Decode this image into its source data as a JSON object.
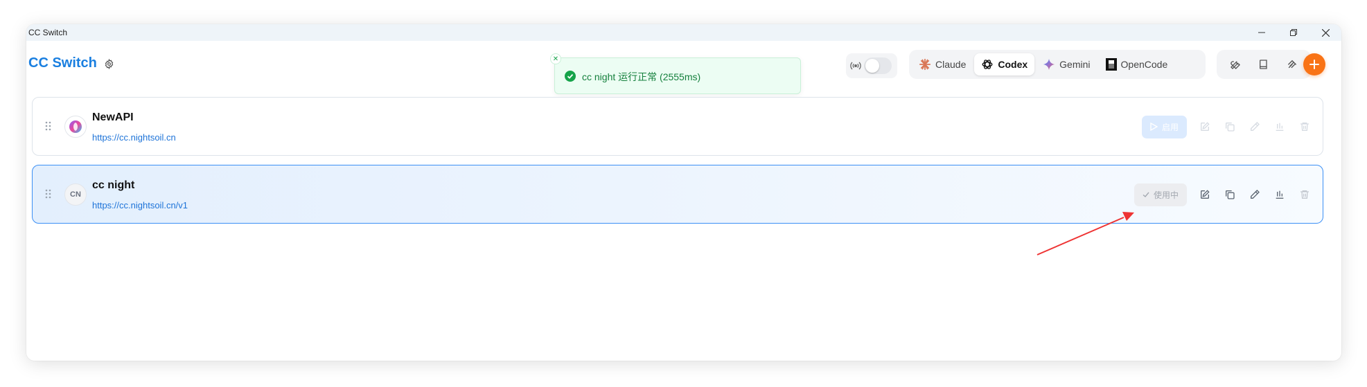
{
  "window": {
    "title": "CC Switch"
  },
  "header": {
    "app_title": "CC Switch"
  },
  "toast": {
    "message": "cc night 运行正常 (2555ms)"
  },
  "app_tabs": [
    {
      "label": "Claude",
      "icon": "claude-icon",
      "active": false
    },
    {
      "label": "Codex",
      "icon": "openai-icon",
      "active": true
    },
    {
      "label": "Gemini",
      "icon": "gemini-icon",
      "active": false
    },
    {
      "label": "OpenCode",
      "icon": "opencode-icon",
      "active": false
    }
  ],
  "providers": [
    {
      "name": "NewAPI",
      "url": "https://cc.nightsoil.cn",
      "avatar": "newapi-logo",
      "action_label": "启用",
      "active": false
    },
    {
      "name": "cc night",
      "url": "https://cc.nightsoil.cn/v1",
      "avatar_text": "CN",
      "action_label": "使用中",
      "active": true
    }
  ],
  "colors": {
    "accent": "#1a7fe0",
    "add_button": "#f97316",
    "toast_bg": "#ecfdf3",
    "toast_text": "#15803d",
    "active_border": "#3b8ff5"
  }
}
